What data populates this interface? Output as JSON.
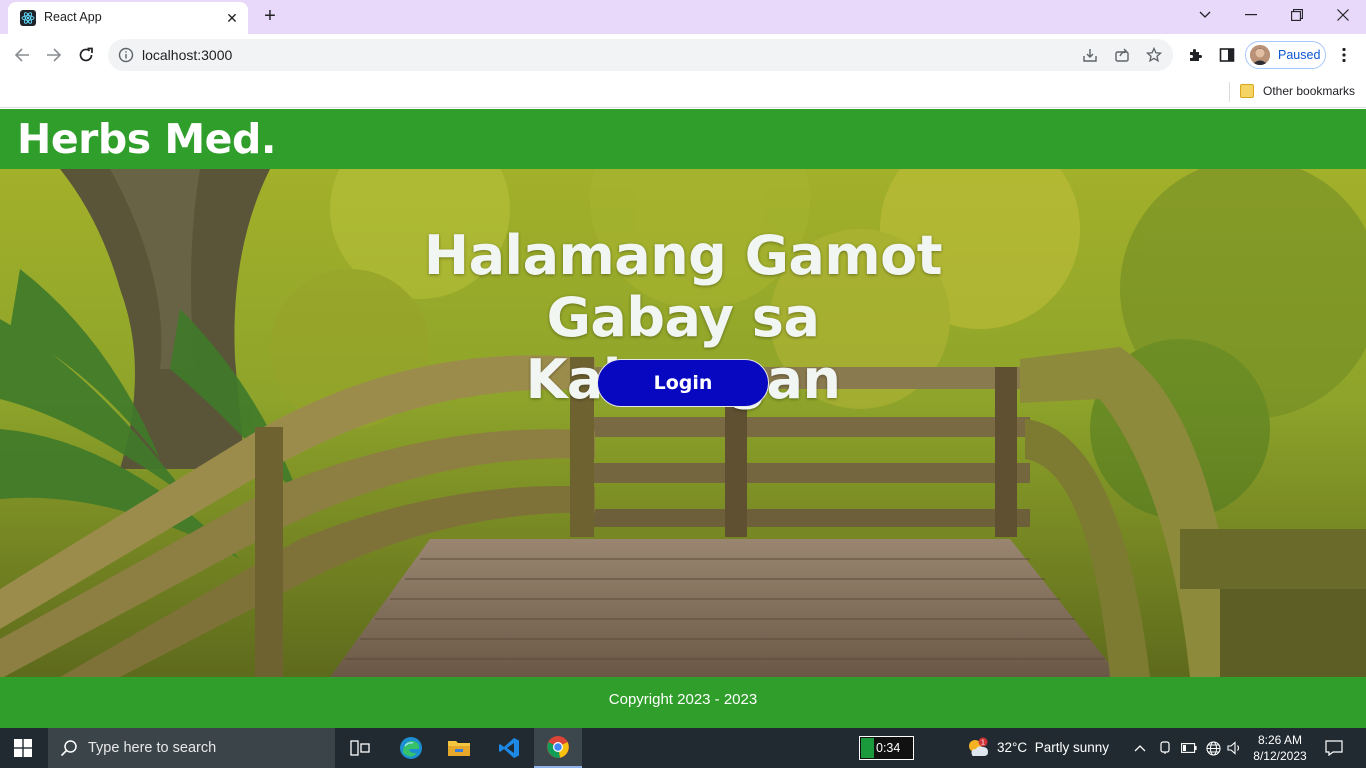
{
  "browser": {
    "tab_title": "React App",
    "url": "localhost:3000",
    "profile_label": "Paused",
    "bookmark_folder": "Other bookmarks"
  },
  "site": {
    "brand": "Herbs Med.",
    "headline_line1": "Halamang Gamot",
    "headline_line2": "Gabay sa Kalusugan",
    "login_label": "Login",
    "footer_text": "Copyright 2023 - 2023",
    "colors": {
      "nav_green": "#2f9e2a",
      "button_blue": "#0808c0",
      "text_white": "#ffffff"
    }
  },
  "taskbar": {
    "search_placeholder": "Type here to search",
    "battery_text": "0:34",
    "battery_level": 0.25,
    "weather_badge": "1",
    "weather_temp": "32°C",
    "weather_desc": "Partly sunny",
    "time": "8:26 AM",
    "date": "8/12/2023",
    "apps": [
      "task-view-icon",
      "edge-icon",
      "file-explorer-icon",
      "vscode-icon",
      "chrome-icon"
    ]
  }
}
